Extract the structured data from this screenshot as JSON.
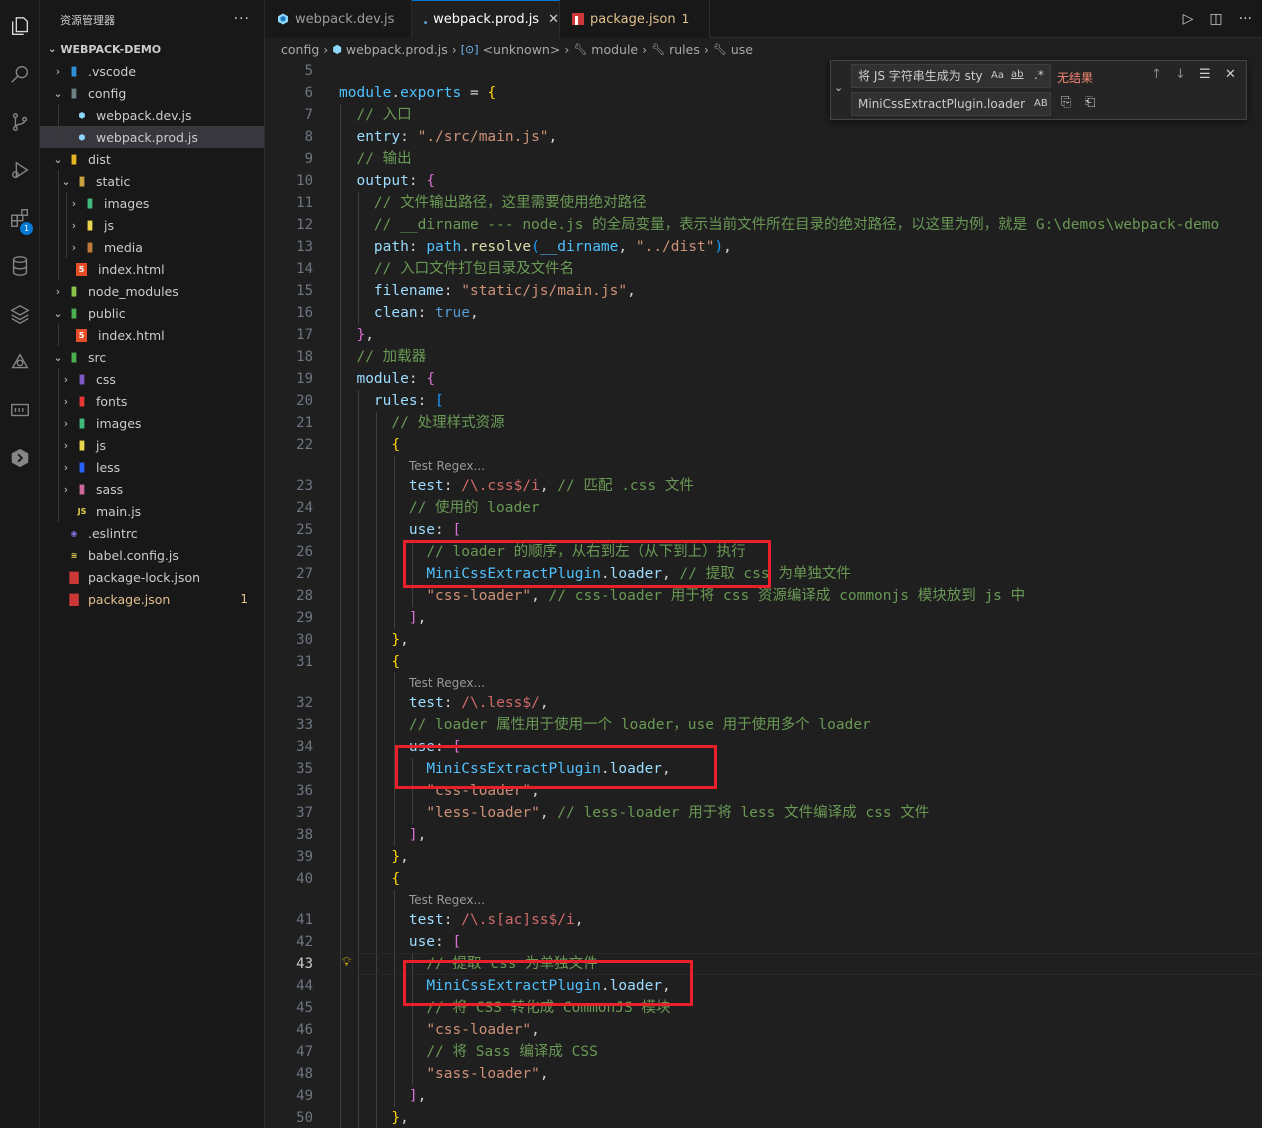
{
  "explorer": {
    "title": "资源管理器",
    "more": "···",
    "project": "WEBPACK-DEMO",
    "items": [
      {
        "name": ".vscode",
        "badge": ""
      },
      {
        "name": "config",
        "badge": ""
      },
      {
        "name": "webpack.dev.js",
        "badge": ""
      },
      {
        "name": "webpack.prod.js",
        "badge": ""
      },
      {
        "name": "dist",
        "badge": ""
      },
      {
        "name": "static",
        "badge": ""
      },
      {
        "name": "images",
        "badge": ""
      },
      {
        "name": "js",
        "badge": ""
      },
      {
        "name": "media",
        "badge": ""
      },
      {
        "name": "index.html",
        "badge": ""
      },
      {
        "name": "node_modules",
        "badge": ""
      },
      {
        "name": "public",
        "badge": ""
      },
      {
        "name": "index.html",
        "badge": ""
      },
      {
        "name": "src",
        "badge": ""
      },
      {
        "name": "css",
        "badge": ""
      },
      {
        "name": "fonts",
        "badge": ""
      },
      {
        "name": "images",
        "badge": ""
      },
      {
        "name": "js",
        "badge": ""
      },
      {
        "name": "less",
        "badge": ""
      },
      {
        "name": "sass",
        "badge": ""
      },
      {
        "name": "main.js",
        "badge": ""
      },
      {
        "name": ".eslintrc",
        "badge": ""
      },
      {
        "name": "babel.config.js",
        "badge": ""
      },
      {
        "name": "package-lock.json",
        "badge": ""
      },
      {
        "name": "package.json",
        "badge": "1"
      }
    ]
  },
  "activity": {
    "extensions_badge": "1"
  },
  "tabs": [
    {
      "label": "webpack.dev.js"
    },
    {
      "label": "webpack.prod.js",
      "close": "✕"
    },
    {
      "label": "package.json",
      "badge": "1"
    }
  ],
  "breadcrumb": [
    "config",
    "webpack.prod.js",
    "<unknown>",
    "module",
    "rules",
    "use"
  ],
  "find": {
    "search_value": "将 JS 字符串生成为 sty",
    "replace_value": "MiniCssExtractPlugin.loader",
    "no_results": "无结果",
    "opt_case": "Aa",
    "opt_word": "ab",
    "opt_regex": ".*",
    "opt_preserve": "AB"
  },
  "editor": {
    "current_line": 43,
    "lines": [
      {
        "n": "5"
      },
      {
        "n": "6"
      },
      {
        "n": "7"
      },
      {
        "n": "8"
      },
      {
        "n": "9"
      },
      {
        "n": "10"
      },
      {
        "n": "11"
      },
      {
        "n": "12"
      },
      {
        "n": "13"
      },
      {
        "n": "14"
      },
      {
        "n": "15"
      },
      {
        "n": "16"
      },
      {
        "n": "17"
      },
      {
        "n": "18"
      },
      {
        "n": "19"
      },
      {
        "n": "20"
      },
      {
        "n": "21"
      },
      {
        "n": "22"
      },
      {
        "n": "23"
      },
      {
        "n": "24"
      },
      {
        "n": "25"
      },
      {
        "n": "26"
      },
      {
        "n": "27"
      },
      {
        "n": "28"
      },
      {
        "n": "29"
      },
      {
        "n": "30"
      },
      {
        "n": "31"
      },
      {
        "n": "32"
      },
      {
        "n": "33"
      },
      {
        "n": "34"
      },
      {
        "n": "35"
      },
      {
        "n": "36"
      },
      {
        "n": "37"
      },
      {
        "n": "38"
      },
      {
        "n": "39"
      },
      {
        "n": "40"
      },
      {
        "n": "41"
      },
      {
        "n": "42"
      },
      {
        "n": "43"
      },
      {
        "n": "44"
      },
      {
        "n": "45"
      },
      {
        "n": "46"
      },
      {
        "n": "47"
      },
      {
        "n": "48"
      },
      {
        "n": "49"
      },
      {
        "n": "50"
      }
    ],
    "codelens": "Test Regex..."
  }
}
